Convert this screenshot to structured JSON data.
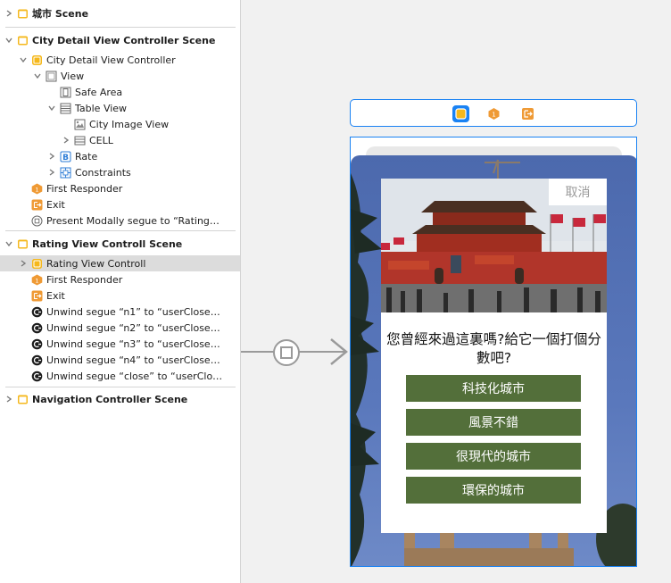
{
  "outline": {
    "rows": [
      {
        "label": "城市 Scene",
        "bold": true,
        "disclosure": "right",
        "icon": "scene-icon"
      },
      {
        "label": "City Detail View Controller Scene",
        "bold": true,
        "disclosure": "down",
        "icon": "scene-icon"
      },
      {
        "label": "City Detail View Controller",
        "disclosure": "down",
        "icon": "view-controller-icon"
      },
      {
        "label": "View",
        "disclosure": "down",
        "icon": "view-icon"
      },
      {
        "label": "Safe Area",
        "icon": "safe-area-icon"
      },
      {
        "label": "Table View",
        "disclosure": "down",
        "icon": "table-view-icon"
      },
      {
        "label": "City Image View",
        "icon": "image-view-icon"
      },
      {
        "label": "CELL",
        "disclosure": "right",
        "icon": "table-cell-icon"
      },
      {
        "label": "Rate",
        "disclosure": "right",
        "icon": "button-icon"
      },
      {
        "label": "Constraints",
        "disclosure": "right",
        "icon": "constraints-icon"
      },
      {
        "label": "First Responder",
        "icon": "first-responder-icon"
      },
      {
        "label": "Exit",
        "icon": "exit-icon"
      },
      {
        "label": "Present Modally segue to “Rating…",
        "icon": "segue-icon"
      },
      {
        "label": "Rating View Controll Scene",
        "bold": true,
        "disclosure": "down",
        "icon": "scene-icon"
      },
      {
        "label": "Rating View Controll",
        "disclosure": "right",
        "icon": "view-controller-icon",
        "selected": true
      },
      {
        "label": "First Responder",
        "icon": "first-responder-icon"
      },
      {
        "label": "Exit",
        "icon": "exit-icon"
      },
      {
        "label": "Unwind segue “n1” to “userClose…",
        "icon": "unwind-segue-icon"
      },
      {
        "label": "Unwind segue “n2” to “userClose…",
        "icon": "unwind-segue-icon"
      },
      {
        "label": "Unwind segue “n3” to “userClose…",
        "icon": "unwind-segue-icon"
      },
      {
        "label": "Unwind segue “n4” to “userClose…",
        "icon": "unwind-segue-icon"
      },
      {
        "label": "Unwind segue “close” to “userClo…",
        "icon": "unwind-segue-icon"
      },
      {
        "label": "Navigation Controller Scene",
        "bold": true,
        "disclosure": "right",
        "icon": "scene-icon"
      }
    ]
  },
  "canvas": {
    "scene_dock_icons": [
      "view-controller-icon",
      "first-responder-icon",
      "exit-icon"
    ],
    "segue_icon": "segue-icon",
    "rating_card": {
      "cancel_label": "取消",
      "question": "您曾經來過這裏嗎?給它一個打個分數吧?",
      "options": [
        "科技化城市",
        "風景不錯",
        "很現代的城市",
        "環保的城市"
      ]
    }
  },
  "colors": {
    "accent": "#1a82f3",
    "option_button": "#536f3a",
    "icon_yellow": "#f5b81c",
    "icon_orange": "#ef9a35"
  }
}
